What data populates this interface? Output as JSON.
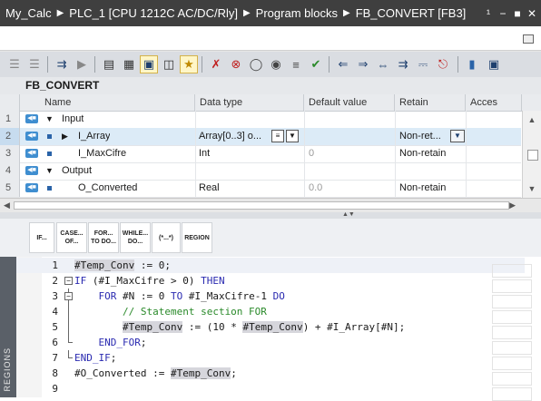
{
  "breadcrumb": {
    "items": [
      "My_Calc",
      "PLC_1 [CPU 1212C AC/DC/Rly]",
      "Program blocks",
      "FB_CONVERT [FB3]"
    ],
    "separator": "▶"
  },
  "window_controls": {
    "more": "¹",
    "minimize": "−",
    "maximize": "■",
    "close": "✕"
  },
  "block": {
    "name": "FB_CONVERT"
  },
  "interface": {
    "columns": [
      "Name",
      "Data type",
      "Default value",
      "Retain",
      "Acces"
    ],
    "rows": [
      {
        "num": "1",
        "section": "Input",
        "name": "",
        "type": "",
        "default": "",
        "retain": ""
      },
      {
        "num": "2",
        "section": "",
        "name": "I_Array",
        "type": "Array[0..3] o...",
        "default": "",
        "retain": "Non-ret..."
      },
      {
        "num": "3",
        "section": "",
        "name": "I_MaxCifre",
        "type": "Int",
        "default": "0",
        "retain": "Non-retain"
      },
      {
        "num": "4",
        "section": "Output",
        "name": "",
        "type": "",
        "default": "",
        "retain": ""
      },
      {
        "num": "5",
        "section": "",
        "name": "O_Converted",
        "type": "Real",
        "default": "0.0",
        "retain": "Non-retain"
      }
    ],
    "io_badge": "◀■"
  },
  "instruction_buttons": [
    {
      "label": "IF..."
    },
    {
      "label": "CASE...\nOF..."
    },
    {
      "label": "FOR...\nTO DO..."
    },
    {
      "label": "WHILE...\nDO..."
    },
    {
      "label": "(*...*)"
    },
    {
      "label": "REGION"
    }
  ],
  "side_label": "REGIONS",
  "code": {
    "lines": [
      {
        "num": "1",
        "text": "#Temp_Conv := 0;"
      },
      {
        "num": "2",
        "text": "IF (#I_MaxCifre > 0) THEN"
      },
      {
        "num": "3",
        "text": "    FOR #N := 0 TO #I_MaxCifre-1 DO"
      },
      {
        "num": "4",
        "text": "        // Statement section FOR"
      },
      {
        "num": "5",
        "text": "        #Temp_Conv := (10 * #Temp_Conv) + #I_Array[#N];"
      },
      {
        "num": "6",
        "text": "    END_FOR;"
      },
      {
        "num": "7",
        "text": "END_IF;"
      },
      {
        "num": "8",
        "text": "#O_Converted := #Temp_Conv;"
      },
      {
        "num": "9",
        "text": ""
      }
    ]
  },
  "icons": {
    "toolbar": [
      "insert-network-icon",
      "insert-network2-icon",
      "expand-icon",
      "download-icon",
      "compile-icon",
      "absolute-address-icon",
      "filter-icon",
      "monitor-icon",
      "favorites-icon",
      "break-icon",
      "break-off-icon",
      "watch-icon",
      "variable-icon",
      "list-icon",
      "checkmark-icon",
      "step-back-icon",
      "step-in-icon",
      "step-over-icon",
      "goto-icon",
      "bookmark-icon",
      "bookmark-clear-icon",
      "marker-icon",
      "window-icon"
    ]
  },
  "colors": {
    "title_bar": "#3f3f3f",
    "selected_row": "#dcebf7",
    "keyword": "#2a2ab0",
    "comment": "#2a8a2a"
  }
}
